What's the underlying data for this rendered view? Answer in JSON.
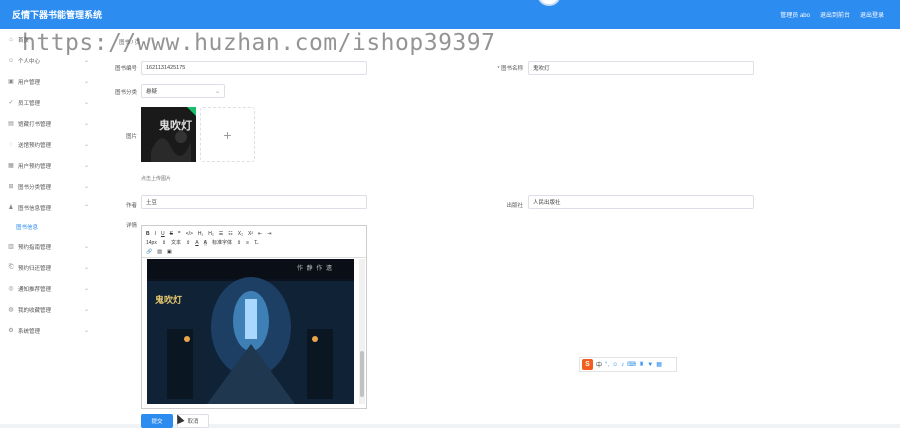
{
  "header": {
    "brand": "反情下器书能管理系统",
    "links": [
      "管理员 abo",
      "退出到前台",
      "退出登录"
    ]
  },
  "sidebar": {
    "items": [
      {
        "icon": "home-icon",
        "label": "首页"
      },
      {
        "icon": "user-icon",
        "label": "个人中心"
      },
      {
        "icon": "users-icon",
        "label": "用户管理"
      },
      {
        "icon": "staff-icon",
        "label": "员工管理"
      },
      {
        "icon": "news-icon",
        "label": "馆藏打书管理"
      },
      {
        "icon": "order-icon",
        "label": "送馆预约管理"
      },
      {
        "icon": "reserve-icon",
        "label": "用户预约管理"
      },
      {
        "icon": "category-icon",
        "label": "图书分类管理"
      },
      {
        "icon": "book-icon",
        "label": "图书信息管理"
      },
      {
        "icon": "info-icon",
        "label": "预约指南管理"
      },
      {
        "icon": "feedback-icon",
        "label": "预约归还管理"
      },
      {
        "icon": "library-icon",
        "label": "通知推荐管理"
      },
      {
        "icon": "collect-icon",
        "label": "我的收藏管理"
      },
      {
        "icon": "settings-icon",
        "label": "系统管理"
      }
    ],
    "active_sub": "图书信息"
  },
  "breadcrumb": "图书 / 页",
  "form": {
    "book_no_label": "图书编号",
    "book_no_value": "1621131425175",
    "book_name_label": "* 图书名称",
    "book_name_value": "鬼吹灯",
    "category_label": "图书分类",
    "category_value": "悬疑",
    "image_label": "图片",
    "upload_hint": "点击上传图片",
    "author_label": "作者",
    "author_value": "土豆",
    "publisher_label": "出版社",
    "publisher_value": "人民出版社",
    "detail_label": "详情",
    "editor_font_size": "14px",
    "editor_text_style": "文本",
    "editor_font_family": "标准字体",
    "editor_banner_text": "作 静 作 遗",
    "submit_label": "提交",
    "cancel_label": "取消"
  },
  "cover": {
    "title": "鬼吹灯"
  },
  "watermark": "https://www.huzhan.com/ishop39397",
  "ime": {
    "lang": "中"
  }
}
